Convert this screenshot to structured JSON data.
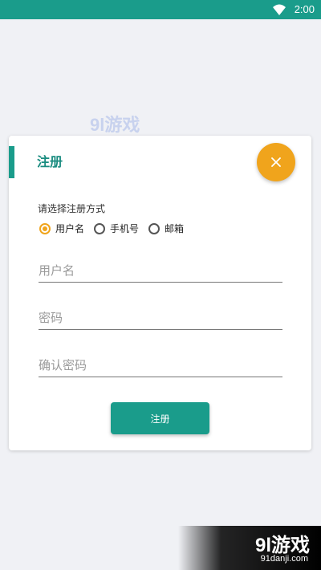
{
  "status_bar": {
    "time": "2:00"
  },
  "watermark": {
    "logo_num": "9l",
    "logo_text": "游戏",
    "url": "91danji.com"
  },
  "dialog": {
    "title": "注册",
    "prompt": "请选择注册方式",
    "options": [
      {
        "label": "用户名",
        "checked": true
      },
      {
        "label": "手机号",
        "checked": false
      },
      {
        "label": "邮箱",
        "checked": false
      }
    ],
    "fields": {
      "username_placeholder": "用户名",
      "password_placeholder": "密码",
      "confirm_placeholder": "确认密码"
    },
    "submit_label": "注册",
    "colors": {
      "primary": "#1a9c8b",
      "accent": "#f0a41c"
    }
  }
}
